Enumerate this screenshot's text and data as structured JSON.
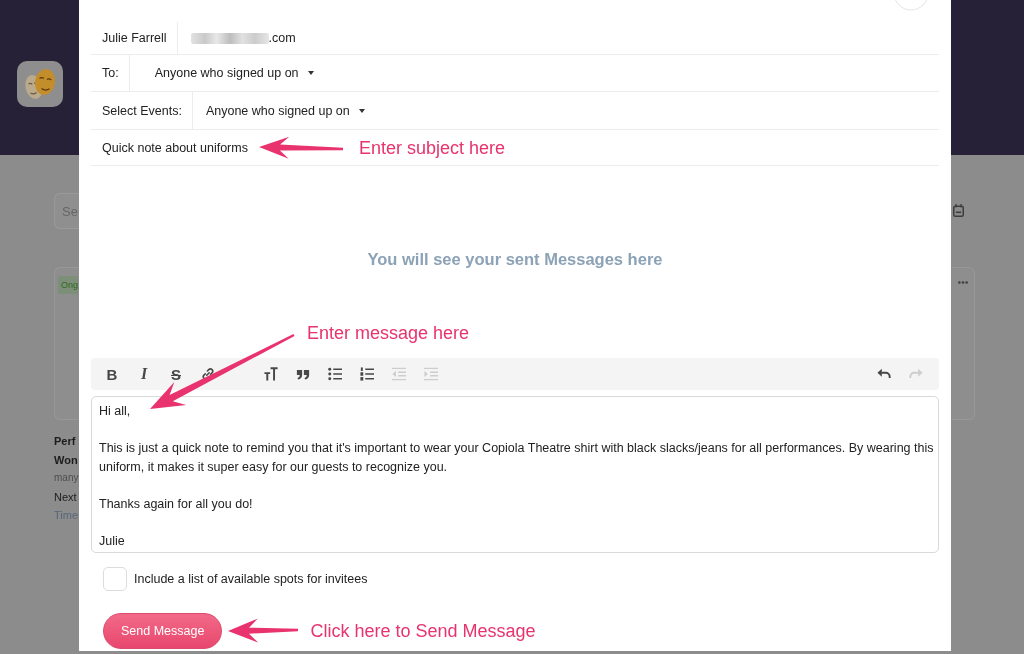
{
  "page": {
    "search": {
      "placeholder": "Se"
    },
    "card": {
      "tag": "Ong"
    },
    "event_lines": [
      {
        "kind": "title",
        "text": "Perf"
      },
      {
        "kind": "title",
        "text": "Won"
      },
      {
        "kind": "meta",
        "text": "many"
      },
      {
        "kind": "date",
        "text": "Next"
      },
      {
        "kind": "time",
        "text": "Time"
      }
    ]
  },
  "modal": {
    "from": {
      "name": "Julie Farrell",
      "address_blurred": true,
      "address": ".com"
    },
    "fields": [
      {
        "label": "To:",
        "value": "Anyone who signed up on"
      },
      {
        "label": "Select Events:",
        "value": "Anyone who signed up on"
      }
    ],
    "subject": {
      "value": "Quick note about uniforms",
      "annotation": "Enter subject here"
    },
    "sent_placeholder": "You will see your sent Messages here",
    "message_annotation": "Enter message here",
    "toolbar": {
      "groups": [
        {
          "buttons": [
            {
              "kind": "bold",
              "label": "B",
              "disabled": false
            },
            {
              "kind": "italic",
              "label": "I",
              "disabled": false
            },
            {
              "kind": "strike",
              "label": "S",
              "disabled": false
            },
            {
              "kind": "link",
              "disabled": false
            }
          ]
        },
        {
          "buttons": [
            {
              "kind": "heading",
              "disabled": false
            },
            {
              "kind": "quote",
              "disabled": false
            },
            {
              "kind": "bullets",
              "disabled": false
            },
            {
              "kind": "numbers",
              "disabled": false
            },
            {
              "kind": "outdent",
              "disabled": true
            },
            {
              "kind": "indent",
              "disabled": true
            }
          ]
        },
        {
          "buttons": [
            {
              "kind": "undo",
              "disabled": false
            },
            {
              "kind": "redo",
              "disabled": true
            }
          ]
        }
      ]
    },
    "message": [
      "Hi all,",
      "This is just a quick note to remind you that it's important to wear your Copiola Theatre shirt with black slacks/jeans for all performances. By wearing this uniform, it makes it super easy for our guests to recognize you.",
      "Thanks again for all you do!",
      "Julie"
    ],
    "include_spots": {
      "label": "Include a list of available spots for invitees",
      "checked": false
    },
    "send": {
      "label": "Send Message",
      "annotation": "Click here to Send Message"
    }
  }
}
